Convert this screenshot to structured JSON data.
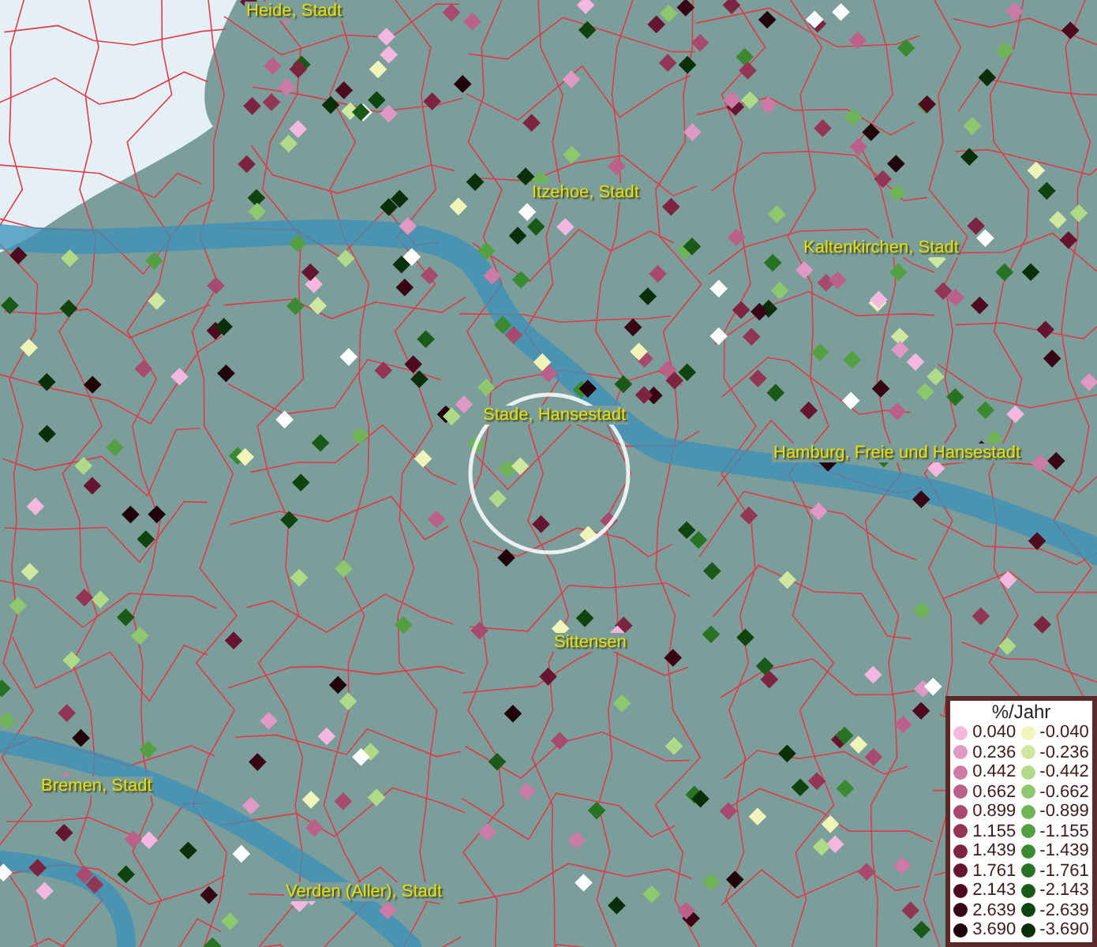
{
  "map": {
    "place_labels": [
      "Heide, Stadt",
      "Itzehoe, Stadt",
      "Kaltenkirchen, Stadt",
      "Stade, Hansestadt",
      "Hamburg, Freie und Hansestadt",
      "Sittensen",
      "Bremen, Stadt",
      "Verden (Aller), Stadt"
    ]
  },
  "legend": {
    "title": "%/Jahr",
    "positive": [
      {
        "value": "0.040",
        "color": "#f4b8e0"
      },
      {
        "value": "0.236",
        "color": "#e098c4"
      },
      {
        "value": "0.442",
        "color": "#cc7aa6"
      },
      {
        "value": "0.662",
        "color": "#bb6088"
      },
      {
        "value": "0.899",
        "color": "#a84a6e"
      },
      {
        "value": "1.155",
        "color": "#933655"
      },
      {
        "value": "1.439",
        "color": "#7c2440"
      },
      {
        "value": "1.761",
        "color": "#661530"
      },
      {
        "value": "2.143",
        "color": "#4e0a1f"
      },
      {
        "value": "2.639",
        "color": "#380514"
      },
      {
        "value": "3.690",
        "color": "#22020a"
      }
    ],
    "negative": [
      {
        "value": "-0.040",
        "color": "#f0f4b8"
      },
      {
        "value": "-0.236",
        "color": "#cfe8a0"
      },
      {
        "value": "-0.442",
        "color": "#b0da88"
      },
      {
        "value": "-0.662",
        "color": "#8ec86e"
      },
      {
        "value": "-0.899",
        "color": "#70b458"
      },
      {
        "value": "-1.155",
        "color": "#52a042"
      },
      {
        "value": "-1.439",
        "color": "#3a8a32"
      },
      {
        "value": "-1.761",
        "color": "#287224"
      },
      {
        "value": "-2.143",
        "color": "#1a5a18"
      },
      {
        "value": "-2.639",
        "color": "#10440f"
      },
      {
        "value": "-3.690",
        "color": "#0a300a"
      }
    ]
  }
}
